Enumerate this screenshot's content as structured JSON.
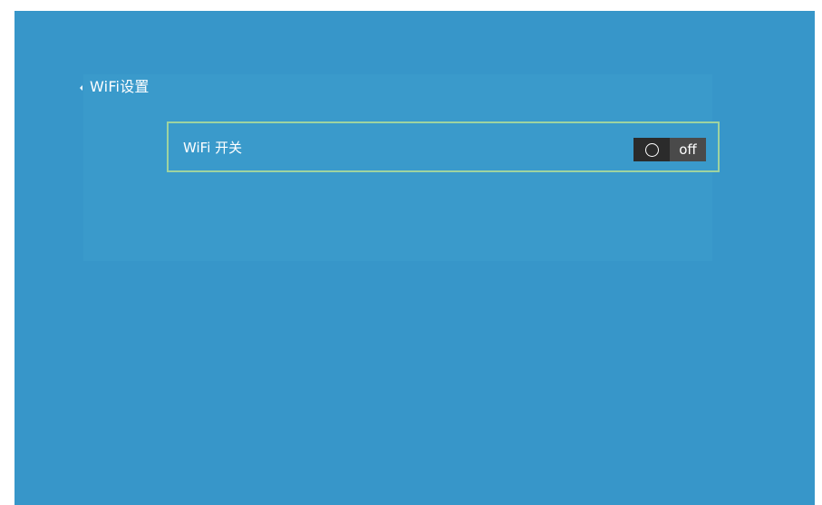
{
  "header": {
    "title": "WiFi设置"
  },
  "settings": {
    "wifi": {
      "label": "WiFi 开关",
      "state": "off"
    }
  }
}
